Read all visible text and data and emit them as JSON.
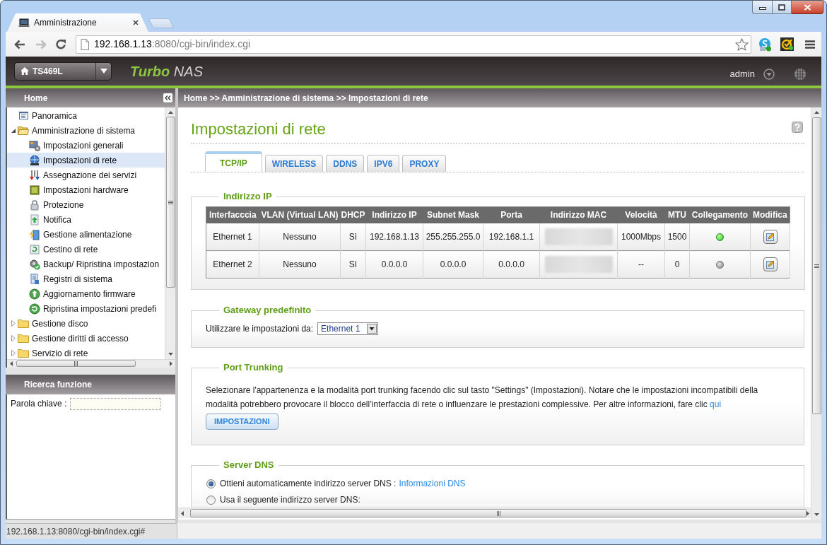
{
  "browser": {
    "tabs": [
      {
        "title": "Amministrazione",
        "selected": true
      }
    ],
    "forward_disabled": true,
    "address": {
      "host": "192.168.1.13",
      "path": ":8080/cgi-bin/index.cgi"
    },
    "status_text": "192.168.1.13:8080/cgi-bin/index.cgi#"
  },
  "header": {
    "device": "TS469L",
    "brand_bold": "Turbo",
    "brand_rest": "NAS",
    "user": "admin"
  },
  "sidebar": {
    "title": "Home",
    "tree": [
      {
        "label": "Panoramica",
        "kind": "page",
        "selected": false
      },
      {
        "label": "Amministrazione di sistema",
        "kind": "folder",
        "expanded": true,
        "selected": false,
        "children": [
          {
            "label": "Impostazioni generali",
            "selected": false
          },
          {
            "label": "Impostazioni di rete",
            "selected": true
          },
          {
            "label": "Assegnazione dei servizi",
            "selected": false
          },
          {
            "label": "Impostazioni hardware",
            "selected": false
          },
          {
            "label": "Protezione",
            "selected": false
          },
          {
            "label": "Notifica",
            "selected": false
          },
          {
            "label": "Gestione alimentazione",
            "selected": false
          },
          {
            "label": "Cestino di rete",
            "selected": false
          },
          {
            "label": "Backup/ Ripristina impostazion",
            "selected": false
          },
          {
            "label": "Registri di sistema",
            "selected": false
          },
          {
            "label": "Aggiornamento firmware",
            "selected": false
          },
          {
            "label": "Ripristina impostazioni predefi",
            "selected": false
          }
        ]
      },
      {
        "label": "Gestione disco",
        "kind": "folder",
        "expanded": false,
        "selected": false
      },
      {
        "label": "Gestione diritti di accesso",
        "kind": "folder",
        "expanded": false,
        "selected": false
      },
      {
        "label": "Servizio di rete",
        "kind": "folder",
        "expanded": false,
        "selected": false
      }
    ],
    "search": {
      "title": "Ricerca funzione",
      "label": "Parola chiave :"
    }
  },
  "breadcrumb": "Home >> Amministrazione di sistema >> Impostazioni di rete",
  "page": {
    "title": "Impostazioni di rete",
    "tabs": [
      {
        "label": "TCP/IP",
        "selected": true
      },
      {
        "label": "WIRELESS",
        "selected": false
      },
      {
        "label": "DDNS",
        "selected": false
      },
      {
        "label": "IPV6",
        "selected": false
      },
      {
        "label": "PROXY",
        "selected": false
      }
    ],
    "ip_section": {
      "title": "Indirizzo IP",
      "columns": [
        "Interfacccia",
        "VLAN (Virtual LAN)",
        "DHCP",
        "Indirizzo IP",
        "Subnet Mask",
        "Porta",
        "Indirizzo MAC",
        "Velocità",
        "MTU",
        "Collegamento",
        "Modifica"
      ],
      "rows": [
        {
          "cells": [
            {
              "kind": "text",
              "text": "Ethernet 1"
            },
            {
              "kind": "text",
              "text": "Nessuno"
            },
            {
              "kind": "text",
              "text": "Sì"
            },
            {
              "kind": "text",
              "text": "192.168.1.13"
            },
            {
              "kind": "text",
              "text": "255.255.255.0"
            },
            {
              "kind": "text",
              "text": "192.168.1.1"
            },
            {
              "kind": "blurred"
            },
            {
              "kind": "text",
              "text": "1000Mbps"
            },
            {
              "kind": "text",
              "text": "1500"
            },
            {
              "kind": "link",
              "connected": true
            },
            {
              "kind": "edit"
            }
          ]
        },
        {
          "cells": [
            {
              "kind": "text",
              "text": "Ethernet 2"
            },
            {
              "kind": "text",
              "text": "Nessuno"
            },
            {
              "kind": "text",
              "text": "Sì"
            },
            {
              "kind": "text",
              "text": "0.0.0.0"
            },
            {
              "kind": "text",
              "text": "0.0.0.0"
            },
            {
              "kind": "text",
              "text": "0.0.0.0"
            },
            {
              "kind": "blurred"
            },
            {
              "kind": "text",
              "text": "--"
            },
            {
              "kind": "text",
              "text": "0"
            },
            {
              "kind": "link",
              "connected": false
            },
            {
              "kind": "edit"
            }
          ]
        }
      ]
    },
    "gateway_section": {
      "title": "Gateway predefinito",
      "label": "Utilizzare le impostazioni da:",
      "value": "Ethernet 1"
    },
    "trunking_section": {
      "title": "Port Trunking",
      "text": "Selezionare l'appartenenza e la modalità port trunking facendo clic sul tasto \"Settings\" (Impostazioni). Notare che le impostazioni incompatibili della modalità potrebbero provocare il blocco dell’interfaccia di rete o influenzare le prestazioni complessive. Per altre informazioni, fare clic",
      "link": "qui",
      "button": "IMPOSTAZIONI"
    },
    "dns_section": {
      "title": "Server DNS",
      "options": [
        {
          "label": "Ottieni automaticamente indirizzo server DNS :",
          "link": "Informazioni DNS",
          "selected": true
        },
        {
          "label": "Usa il seguente indirizzo server DNS:",
          "selected": false
        }
      ]
    }
  }
}
